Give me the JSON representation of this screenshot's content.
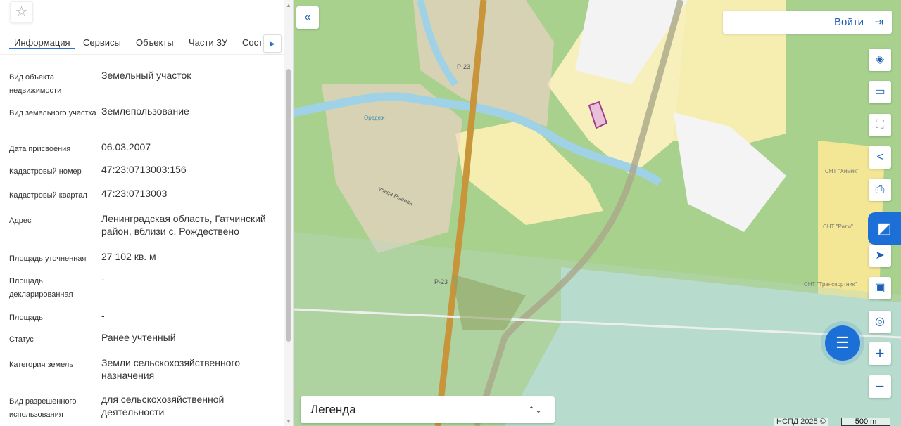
{
  "panel": {
    "tabs": [
      "Информация",
      "Сервисы",
      "Объекты",
      "Части ЗУ",
      "Состав"
    ],
    "fields": [
      {
        "label": "Вид объекта недвижимости",
        "value": "Земельный участок"
      },
      {
        "label": "Вид земельного участка",
        "value": "Землепользование"
      },
      {
        "label": "Дата присвоения",
        "value": "06.03.2007"
      },
      {
        "label": "Кадастровый номер",
        "value": "47:23:0713003:156"
      },
      {
        "label": "Кадастровый квартал",
        "value": "47:23:0713003"
      },
      {
        "label": "Адрес",
        "value": "Ленинградская область, Гатчинский район, вблизи с. Рождествено"
      },
      {
        "label": "Площадь уточненная",
        "value": "27 102 кв. м"
      },
      {
        "label": "Площадь декларированная",
        "value": "-"
      },
      {
        "label": "Площадь",
        "value": "-"
      },
      {
        "label": "Статус",
        "value": "Ранее учтенный"
      },
      {
        "label": "Категория земель",
        "value": "Земли сельскохозяйственного назначения"
      },
      {
        "label": "Вид разрешенного использования",
        "value": "для сельскохозяйственной деятельности"
      }
    ]
  },
  "map": {
    "login_label": "Войти",
    "legend_label": "Легенда",
    "copyright": "НСПД 2025 ©",
    "scale_label": "500 m",
    "labels": {
      "road": "Р-23",
      "road2": "Р-23",
      "snt1": "СНТ \"Химик\"",
      "snt2": "СНТ \"Ратм\"",
      "snt3": "СНТ \"Транспортник\"",
      "river": "Оредеж",
      "street": "улица Рыцева"
    }
  },
  "colors": {
    "accent": "#1c5fb3",
    "forest": "#a9d18e",
    "field": "#f8efb5"
  }
}
